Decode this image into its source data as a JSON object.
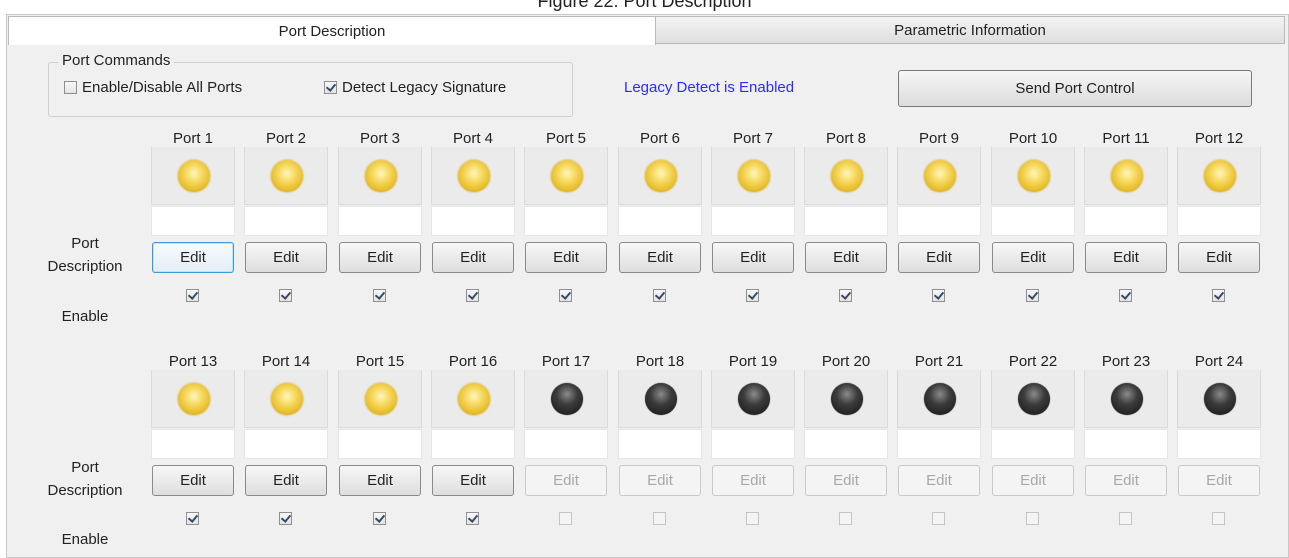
{
  "caption": "Figure 22: Port Description",
  "tabs": {
    "active": "Port Description",
    "inactive": "Parametric Information"
  },
  "port_commands": {
    "title": "Port Commands",
    "enable_all_label": "Enable/Disable All Ports",
    "enable_all_checked": false,
    "detect_legacy_label": "Detect Legacy Signature",
    "detect_legacy_checked": true
  },
  "legacy_status": "Legacy Detect is Enabled",
  "send_button": "Send Port Control",
  "row_labels": {
    "port": "Port",
    "description": "Description",
    "enable": "Enable"
  },
  "edit_label": "Edit",
  "ports": [
    {
      "name": "Port 1",
      "led": "on",
      "edit_enabled": true,
      "enabled": true
    },
    {
      "name": "Port 2",
      "led": "on",
      "edit_enabled": true,
      "enabled": true
    },
    {
      "name": "Port 3",
      "led": "on",
      "edit_enabled": true,
      "enabled": true
    },
    {
      "name": "Port 4",
      "led": "on",
      "edit_enabled": true,
      "enabled": true
    },
    {
      "name": "Port 5",
      "led": "on",
      "edit_enabled": true,
      "enabled": true
    },
    {
      "name": "Port 6",
      "led": "on",
      "edit_enabled": true,
      "enabled": true
    },
    {
      "name": "Port 7",
      "led": "on",
      "edit_enabled": true,
      "enabled": true
    },
    {
      "name": "Port 8",
      "led": "on",
      "edit_enabled": true,
      "enabled": true
    },
    {
      "name": "Port 9",
      "led": "on",
      "edit_enabled": true,
      "enabled": true
    },
    {
      "name": "Port 10",
      "led": "on",
      "edit_enabled": true,
      "enabled": true
    },
    {
      "name": "Port 11",
      "led": "on",
      "edit_enabled": true,
      "enabled": true
    },
    {
      "name": "Port 12",
      "led": "on",
      "edit_enabled": true,
      "enabled": true
    },
    {
      "name": "Port 13",
      "led": "on",
      "edit_enabled": true,
      "enabled": true
    },
    {
      "name": "Port 14",
      "led": "on",
      "edit_enabled": true,
      "enabled": true
    },
    {
      "name": "Port 15",
      "led": "on",
      "edit_enabled": true,
      "enabled": true
    },
    {
      "name": "Port 16",
      "led": "on",
      "edit_enabled": true,
      "enabled": true
    },
    {
      "name": "Port 17",
      "led": "off",
      "edit_enabled": false,
      "enabled": false
    },
    {
      "name": "Port 18",
      "led": "off",
      "edit_enabled": false,
      "enabled": false
    },
    {
      "name": "Port 19",
      "led": "off",
      "edit_enabled": false,
      "enabled": false
    },
    {
      "name": "Port 20",
      "led": "off",
      "edit_enabled": false,
      "enabled": false
    },
    {
      "name": "Port 21",
      "led": "off",
      "edit_enabled": false,
      "enabled": false
    },
    {
      "name": "Port 22",
      "led": "off",
      "edit_enabled": false,
      "enabled": false
    },
    {
      "name": "Port 23",
      "led": "off",
      "edit_enabled": false,
      "enabled": false
    },
    {
      "name": "Port 24",
      "led": "off",
      "edit_enabled": false,
      "enabled": false
    }
  ],
  "colors": {
    "legacy_status": "#2c2cff",
    "led_on": "#e9bf2c",
    "led_off": "#151515",
    "focus_border": "#3c9bd6"
  }
}
